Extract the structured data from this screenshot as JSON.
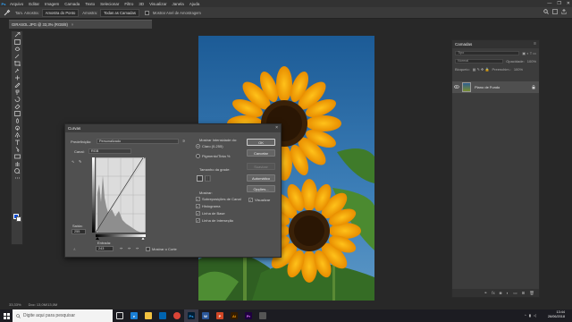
{
  "menubar": {
    "items": [
      "Arquivo",
      "Editar",
      "Imagem",
      "Camada",
      "Texto",
      "Selecionar",
      "Filtro",
      "3D",
      "Visualizar",
      "Janela",
      "Ajuda"
    ],
    "window_controls": [
      "—",
      "❐",
      "✕"
    ]
  },
  "optbar": {
    "size_label": "Tam. Amostra:",
    "size_value": "Amostra do Ponto",
    "sample_label": "Amostra:",
    "sample_value": "Todas as Camadas",
    "ring_label": "Mostrar Anel de Amostragem"
  },
  "doc_tab": {
    "label": "GIRASOL.JPG @ 33,3% (RGB/8)",
    "close": "×"
  },
  "curves": {
    "title": "Curvas",
    "close": "×",
    "preset_label": "Predefinição:",
    "preset_value": "Personalizado",
    "channel_label": "Canal:",
    "channel_value": "RGB",
    "output_label": "Saída:",
    "output_value": "255",
    "input_label": "Entrada:",
    "input_value": "243",
    "show_clipping_label": "Mostrar o Corte",
    "display_heading": "Mostrar Intensidade do:",
    "light_label": "Claro (0-255)",
    "pigment_label": "Pigmento/Tinta %",
    "grid_size_label": "Tamanho da grade:",
    "show_heading": "Mostrar:",
    "show_options": [
      "Sobreposições de Canal",
      "Histograma",
      "Linha de Base",
      "Linha de Interseção"
    ],
    "buttons": {
      "ok": "OK",
      "cancel": "Cancelar",
      "smooth": "Suavizar",
      "auto": "Automático",
      "options": "Opções..."
    },
    "preview_label": "Visualizar",
    "curve_points": [
      [
        0,
        0
      ],
      [
        243,
        255
      ]
    ]
  },
  "layers": {
    "title": "Camadas",
    "kind_placeholder": "Tipo",
    "blend_mode": "Normal",
    "opacity_label": "Opacidade:",
    "opacity_value": "100%",
    "lock_label": "Bloqueio:",
    "fill_label": "Preenchim.:",
    "fill_value": "100%",
    "layer_name": "Plano de Fundo"
  },
  "statusbar": {
    "zoom": "33,33%",
    "doc_size": "Doc: 13,0M/13,0M"
  },
  "taskbar": {
    "search_placeholder": "Digite aqui para pesquisar",
    "time": "13:44",
    "date": "26/06/2018"
  },
  "colors": {
    "accent": "#31a8ff",
    "foreground_color": "#0a4ed8",
    "background_color": "#ffffff"
  }
}
